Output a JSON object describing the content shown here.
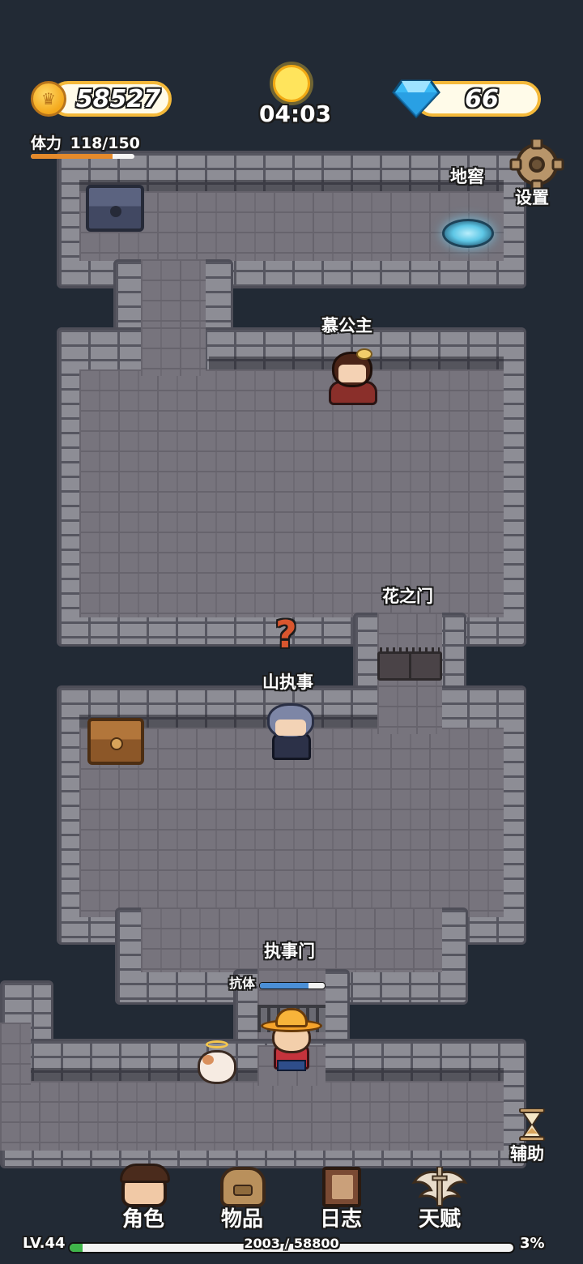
{
  "hud": {
    "gold": "58527",
    "timer": "04:03",
    "gems": "66",
    "stamina_label": "体力",
    "stamina_value": "118/150",
    "stamina_fraction": 0.79
  },
  "side_buttons": {
    "settings_label": "设置",
    "assist_label": "辅助"
  },
  "map_labels": {
    "cellar": "地窖",
    "princess": "慕公主",
    "flower_gate": "花之门",
    "steward": "山执事",
    "steward_gate": "执事门",
    "antibody": "抗体",
    "question_mark": "?"
  },
  "player": {
    "antibody_fraction": 0.75
  },
  "menu": {
    "character": "角色",
    "items": "物品",
    "journal": "日志",
    "talent": "天赋"
  },
  "level": {
    "level_label": "LV.44",
    "xp_text": "2003 / 58800",
    "xp_percent": "3%",
    "xp_fraction": 0.03
  },
  "colors": {
    "background": "#222a35",
    "gold_border": "#f4b93a",
    "xp_fill": "#3fb54a",
    "stamina_fill": "#e58a2b"
  }
}
